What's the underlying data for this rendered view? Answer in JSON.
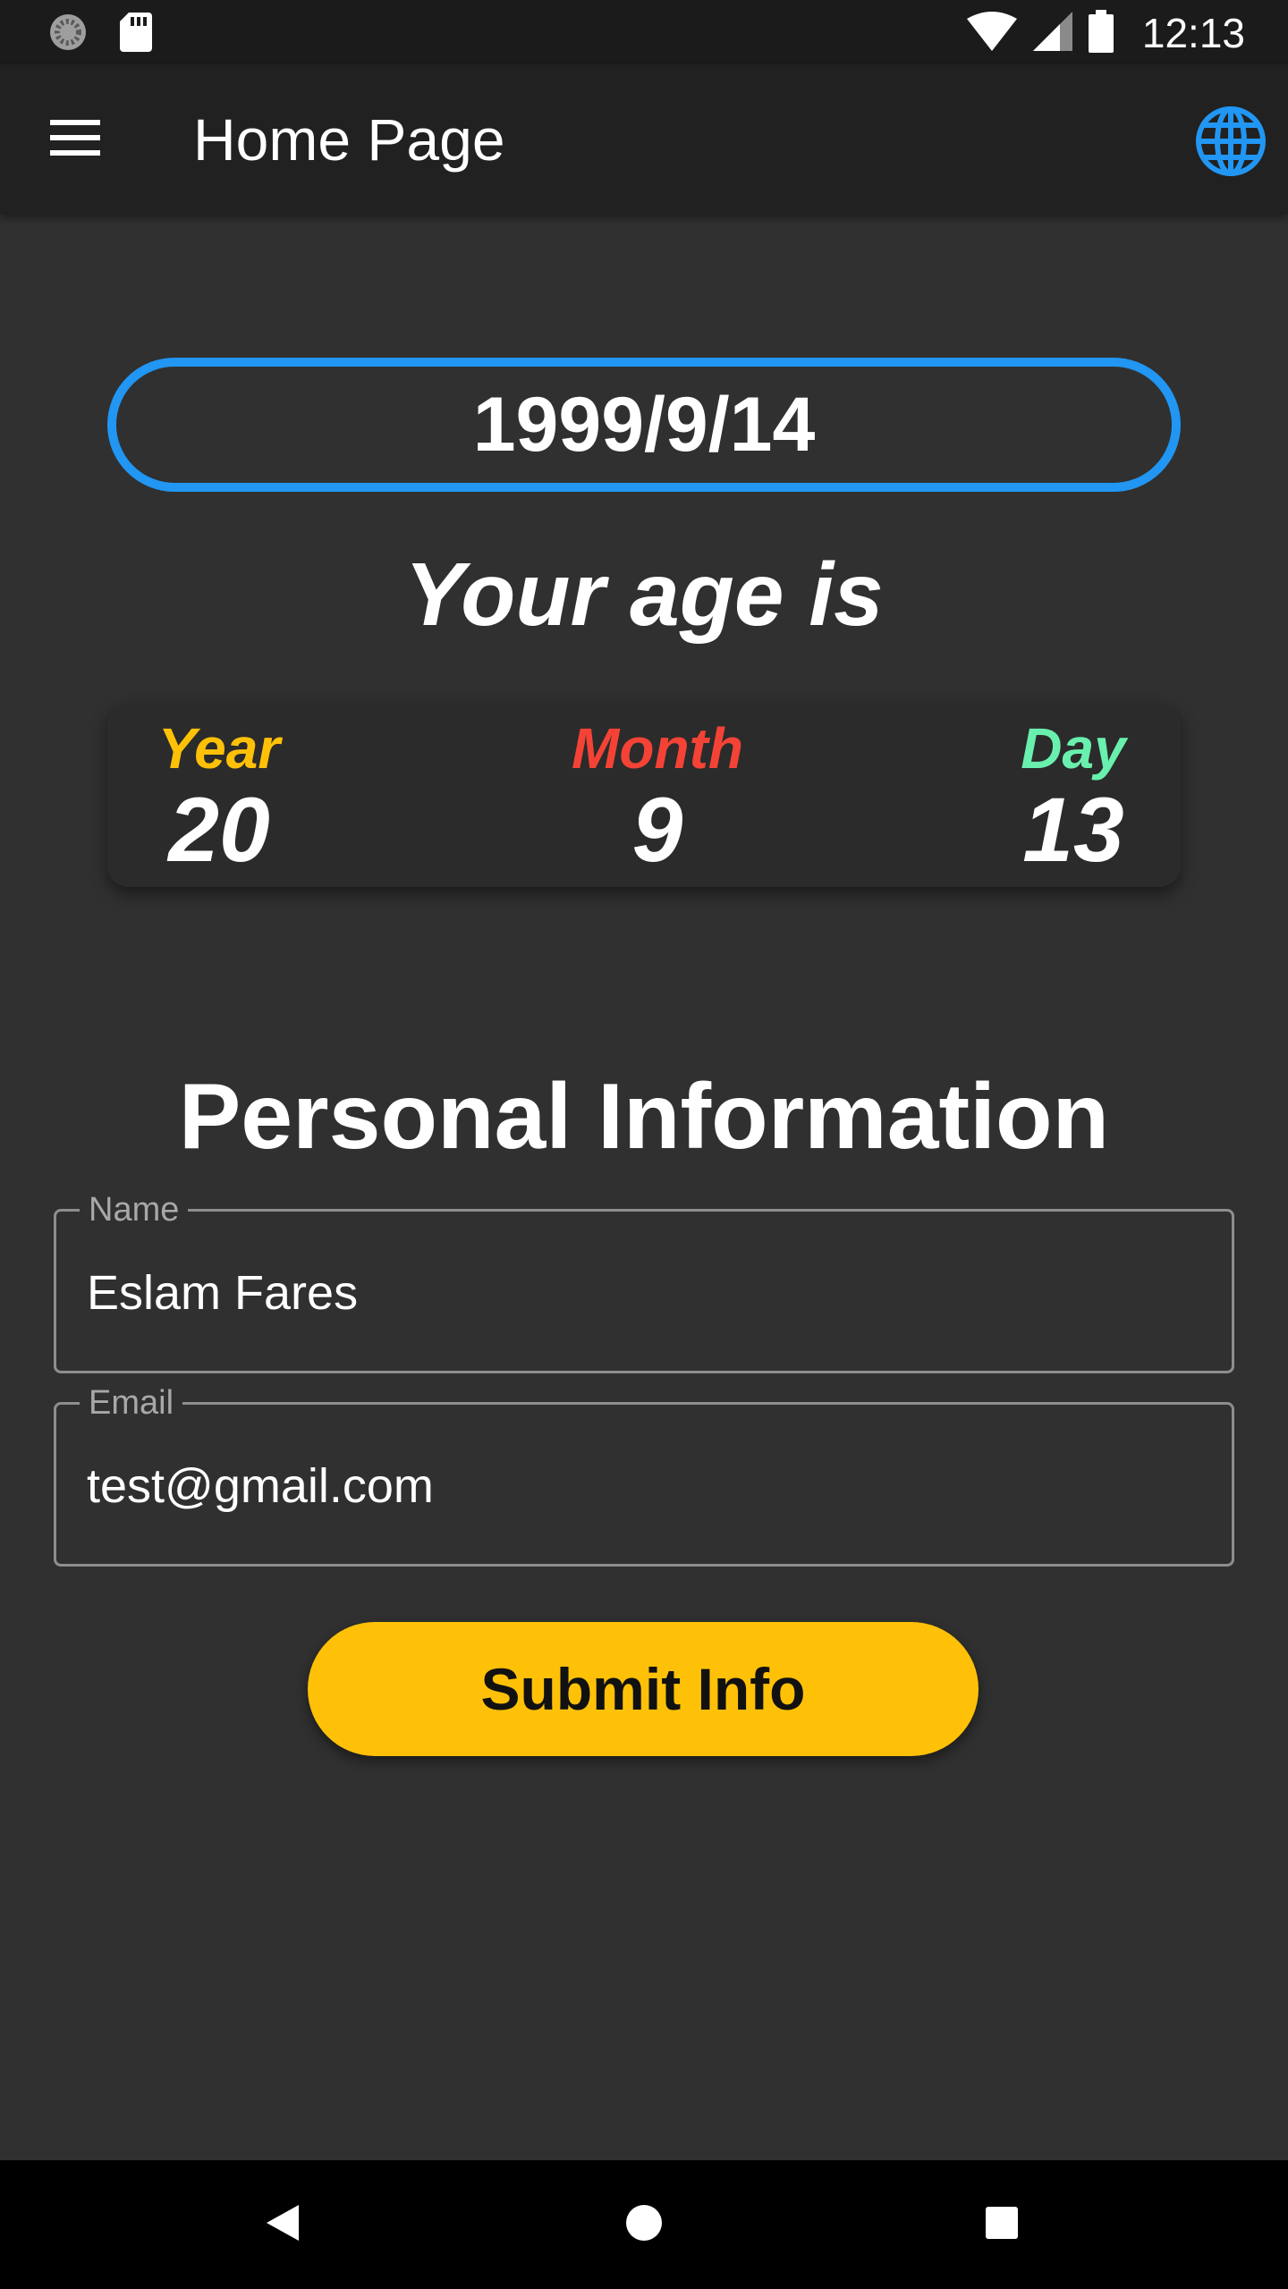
{
  "status_bar": {
    "time": "12:13",
    "icons": [
      "sync-icon",
      "sd-card-icon",
      "wifi-icon",
      "signal-icon",
      "battery-icon"
    ]
  },
  "app_bar": {
    "title": "Home Page",
    "menu_icon": "hamburger-menu-icon",
    "action_icon": "globe-icon",
    "accent_color": "#2196f3"
  },
  "date_picker": {
    "value": "1999/9/14",
    "border_color": "#2196f3"
  },
  "age": {
    "heading": "Your age is",
    "year": {
      "label": "Year",
      "value": "20",
      "color": "#ffc107"
    },
    "month": {
      "label": "Month",
      "value": "9",
      "color": "#f44336"
    },
    "day": {
      "label": "Day",
      "value": "13",
      "color": "#69f0ae"
    }
  },
  "form": {
    "title": "Personal Information",
    "name": {
      "label": "Name",
      "value": "Eslam Fares"
    },
    "email": {
      "label": "Email",
      "value": "test@gmail.com"
    },
    "submit_label": "Submit Info",
    "submit_color": "#ffc107"
  },
  "nav_bar": {
    "icons": [
      "back-icon",
      "home-icon",
      "recents-icon"
    ]
  }
}
